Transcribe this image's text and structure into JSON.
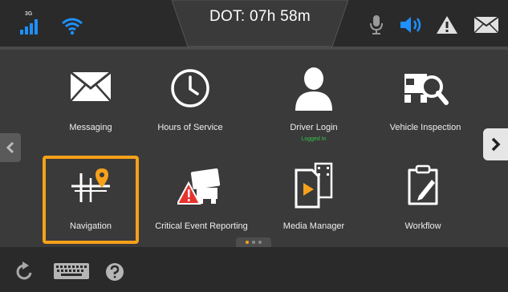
{
  "status_bar": {
    "network_type": "3G",
    "dot_label": "DOT: 07h 58m",
    "icons": [
      "signal-icon",
      "wifi-icon",
      "microphone-icon",
      "speaker-icon",
      "warning-icon",
      "mail-icon"
    ]
  },
  "apps": [
    {
      "label": "Messaging",
      "sublabel": "",
      "icon": "envelope-icon"
    },
    {
      "label": "Hours of Service",
      "sublabel": "",
      "icon": "clock-icon"
    },
    {
      "label": "Driver Login",
      "sublabel": "Logged In",
      "icon": "user-icon"
    },
    {
      "label": "Vehicle Inspection",
      "sublabel": "",
      "icon": "truck-magnifier-icon"
    },
    {
      "label": "Navigation",
      "sublabel": "",
      "icon": "map-pin-icon"
    },
    {
      "label": "Critical Event Reporting",
      "sublabel": "",
      "icon": "truck-warning-icon"
    },
    {
      "label": "Media Manager",
      "sublabel": "",
      "icon": "media-file-icon"
    },
    {
      "label": "Workflow",
      "sublabel": "",
      "icon": "clipboard-pen-icon"
    }
  ],
  "pager": {
    "pages": 3,
    "current": 1
  },
  "colors": {
    "highlight": "#f7a11a",
    "accent_blue": "#1e90ff",
    "logged_in": "#39c24a"
  }
}
